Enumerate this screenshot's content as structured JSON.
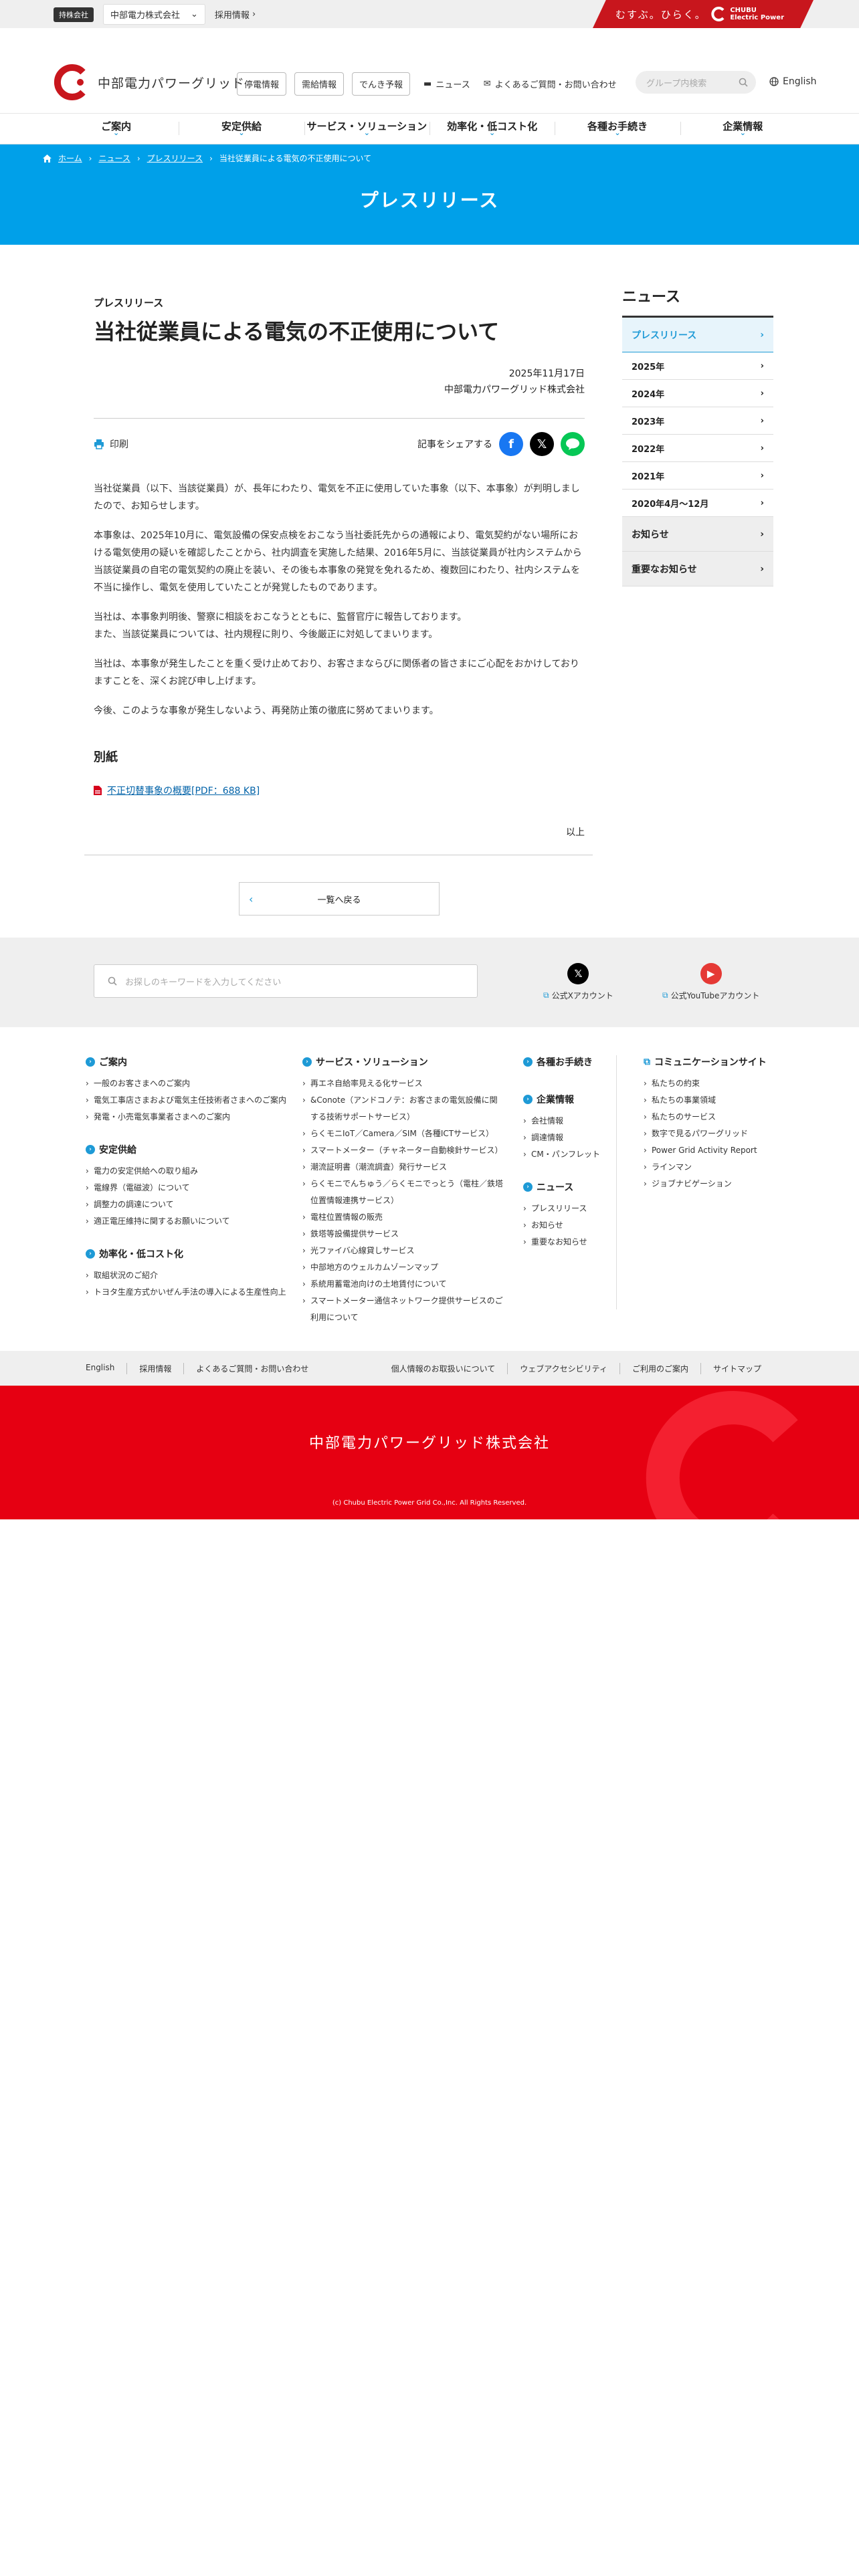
{
  "utility": {
    "group_badge": "持株会社",
    "group_company": "中部電力株式会社",
    "recruit": "採用情報",
    "slogan": "むすぶ。ひらく。",
    "brand_line1": "CHUBU",
    "brand_line2": "Electric Power"
  },
  "header": {
    "logo_text": "中部電力パワーグリッド",
    "outage_info": "停電情報",
    "power_supply": "需給情報",
    "forecast": "でんき予報",
    "news": "ニュース",
    "faq": "よくあるご質問・お問い合わせ",
    "search_placeholder": "グループ内検索",
    "english": "English"
  },
  "gnav": [
    "ご案内",
    "安定供給",
    "サービス・ソリューション",
    "効率化・低コスト化",
    "各種お手続き",
    "企業情報"
  ],
  "breadcrumb": {
    "home": "ホーム",
    "news": "ニュース",
    "press": "プレスリリース",
    "current": "当社従業員による電気の不正使用について"
  },
  "hero_title": "プレスリリース",
  "article": {
    "kicker": "プレスリリース",
    "title": "当社従業員による電気の不正使用について",
    "date": "2025年11月17日",
    "company": "中部電力パワーグリッド株式会社",
    "print": "印刷",
    "share_label": "記事をシェアする",
    "paragraphs": [
      "当社従業員（以下、当該従業員）が、長年にわたり、電気を不正に使用していた事象（以下、本事象）が判明しましたので、お知らせします。",
      "本事象は、2025年10月に、電気設備の保安点検をおこなう当社委託先からの通報により、電気契約がない場所における電気使用の疑いを確認したことから、社内調査を実施した結果、2016年5月に、当該従業員が社内システムから当該従業員の自宅の電気契約の廃止を装い、その後も本事象の発覚を免れるため、複数回にわたり、社内システムを不当に操作し、電気を使用していたことが発覚したものであります。",
      "当社は、本事象判明後、警察に相談をおこなうとともに、監督官庁に報告しております。\nまた、当該従業員については、社内規程に則り、今後厳正に対処してまいります。",
      "当社は、本事象が発生したことを重く受け止めており、お客さまならびに関係者の皆さまにご心配をおかけしておりますことを、深くお詫び申し上げます。",
      "今後、このような事象が発生しないよう、再発防止策の徹底に努めてまいります。"
    ],
    "attachment_title": "別紙",
    "attachment_link": "不正切替事象の概要[PDF：688 KB]",
    "closing": "以上",
    "back": "一覧へ戻る"
  },
  "sidebar": {
    "title": "ニュース",
    "items": [
      "プレスリリース",
      "2025年",
      "2024年",
      "2023年",
      "2022年",
      "2021年",
      "2020年4月～12月",
      "お知らせ",
      "重要なお知らせ"
    ]
  },
  "search_band": {
    "placeholder": "お探しのキーワードを入力してください",
    "x_account": "公式Xアカウント",
    "youtube_account": "公式YouTubeアカウント"
  },
  "sitemap": {
    "annai": {
      "title": "ご案内",
      "items": [
        "一般のお客さまへのご案内",
        "電気工事店さまおよび電気主任技術者さまへのご案内",
        "発電・小売電気事業者さまへのご案内"
      ]
    },
    "antei": {
      "title": "安定供給",
      "items": [
        "電力の安定供給への取り組み",
        "電線界（電磁波）について",
        "調整力の調達について",
        "適正電圧維持に関するお願いについて"
      ]
    },
    "kouritsu": {
      "title": "効率化・低コスト化",
      "items": [
        "取組状況のご紹介",
        "トヨタ生産方式かいぜん手法の導入による生産性向上"
      ]
    },
    "service": {
      "title": "サービス・ソリューション",
      "items": [
        "再エネ自給率見える化サービス",
        "&Conote（アンドコノテ：お客さまの電気設備に関する技術サポートサービス）",
        "らくモニIoT／Camera／SIM（各種ICTサービス）",
        "スマートメーター（チャネーター自動検針サービス）",
        "潮流証明書（潮流調査）発行サービス",
        "らくモニでんちゅう／らくモニでっとう（電柱／鉄塔位置情報連携サービス）",
        "電柱位置情報の販売",
        "鉄塔等設備提供サービス",
        "光ファイバ心線貸しサービス",
        "中部地方のウェルカムゾーンマップ",
        "系統用蓄電池向けの土地賃付について",
        "スマートメーター通信ネットワーク提供サービスのご利用について"
      ]
    },
    "tetsuzuki": {
      "title": "各種お手続き"
    },
    "kigyou": {
      "title": "企業情報",
      "items": [
        "会社情報",
        "調達情報",
        "CM・パンフレット"
      ]
    },
    "news": {
      "title": "ニュース",
      "items": [
        "プレスリリース",
        "お知らせ",
        "重要なお知らせ"
      ]
    },
    "comm": {
      "title": "コミュニケーションサイト",
      "items": [
        "私たちの約束",
        "私たちの事業領域",
        "私たちのサービス",
        "数字で見るパワーグリッド",
        "Power Grid Activity Report",
        "ラインマン",
        "ジョブナビゲーション"
      ]
    }
  },
  "footer_nav": {
    "left": [
      "English",
      "採用情報",
      "よくあるご質問・お問い合わせ"
    ],
    "right": [
      "個人情報のお取扱いについて",
      "ウェブアクセシビリティ",
      "ご利用のご案内",
      "サイトマップ"
    ]
  },
  "footer": {
    "company": "中部電力パワーグリッド株式会社",
    "copyright": "(c) Chubu Electric Power Grid Co.,Inc. All Rights Reserved."
  },
  "colors": {
    "brand_red": "#e60012",
    "accent_blue": "#00a0e9"
  }
}
